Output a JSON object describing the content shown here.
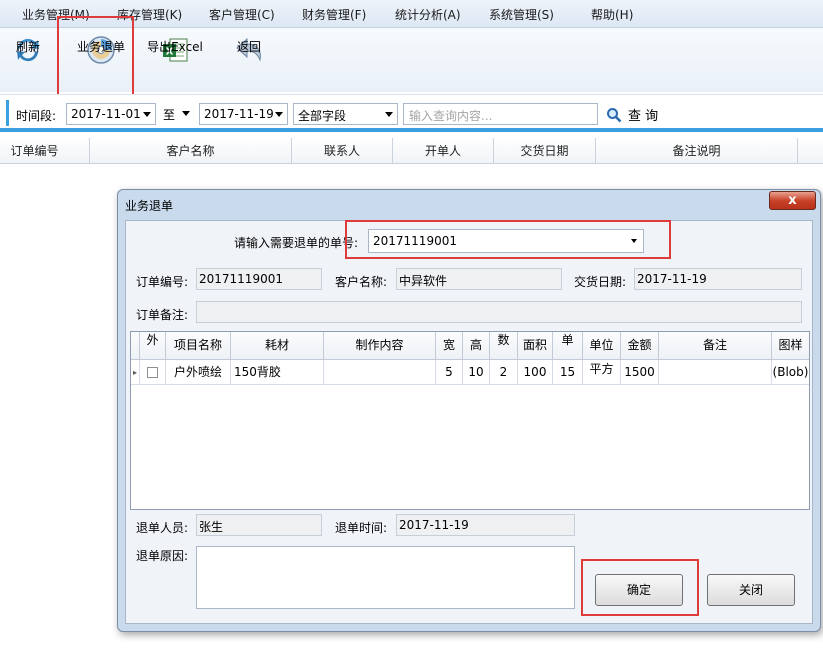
{
  "menu": {
    "items": [
      "业务管理(M)",
      "库存管理(K)",
      "客户管理(C)",
      "财务管理(F)",
      "统计分析(A)",
      "系统管理(S)",
      "帮助(H)"
    ]
  },
  "toolbar": {
    "refresh_label": "刷新",
    "return_order_label": "业务退单",
    "export_label": "导出Excel",
    "back_label": "返回"
  },
  "filter": {
    "period_label": "时间段:",
    "start_date": "2017-11-01",
    "to_label": "至",
    "end_date": "2017-11-19",
    "field_select": "全部字段",
    "search_placeholder": "输入查询内容...",
    "search_label": "查 询"
  },
  "grid": {
    "columns": [
      "订单编号",
      "客户名称",
      "联系人",
      "开单人",
      "交货日期",
      "备注说明"
    ]
  },
  "dialog": {
    "title": "业务退单",
    "close_glyph": "x",
    "order_no_prompt": "请输入需要退单的单号:",
    "order_no_value": "20171119001",
    "order_no_label": "订单编号:",
    "order_no": "20171119001",
    "customer_label": "客户名称:",
    "customer": "中异软件",
    "delivery_label": "交货日期:",
    "delivery_date": "2017-11-19",
    "remark_label": "订单备注:",
    "remark": "",
    "table": {
      "columns": [
        "外",
        "项目名称",
        "耗材",
        "制作内容",
        "宽",
        "高",
        "数",
        "面积",
        "单",
        "单位",
        "金额",
        "备注",
        "图样"
      ],
      "rows": [
        [
          "",
          "户外喷绘",
          "150背胶",
          "",
          "5",
          "10",
          "2",
          "100",
          "15",
          "平方",
          "1500",
          "",
          "(Blob)"
        ]
      ]
    },
    "staff_label": "退单人员:",
    "staff": "张生",
    "time_label": "退单时间:",
    "time": "2017-11-19",
    "reason_label": "退单原因:",
    "reason": "",
    "confirm_label": "确定",
    "close_label": "关闭"
  }
}
